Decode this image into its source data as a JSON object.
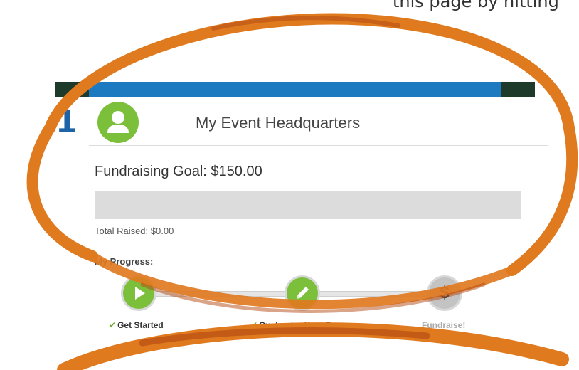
{
  "caption": {
    "text": "this page by hitting"
  },
  "header": {
    "step_number": "1",
    "avatar_icon": "user-icon",
    "title": "My Event Headquarters"
  },
  "fundraising": {
    "goal_text": "Fundraising Goal: $150.00",
    "progress_fraction": 0,
    "raised_text": "Total Raised: $0.00"
  },
  "progress": {
    "heading": "My Progress:",
    "steps": [
      {
        "label": "Get Started",
        "icon": "play-icon",
        "status": "complete",
        "check": "✔"
      },
      {
        "label": "Customize Your Page",
        "icon": "pencil-icon",
        "status": "complete",
        "check": "✔"
      },
      {
        "label": "Fundraise!",
        "icon": "dollar-icon",
        "status": "incomplete",
        "glyph": "$"
      }
    ]
  },
  "colors": {
    "brand_blue": "#1e7ac0",
    "step_green": "#7cbf3b",
    "step_gray": "#c3c3c3",
    "annotation_orange": "#e07a1f"
  }
}
